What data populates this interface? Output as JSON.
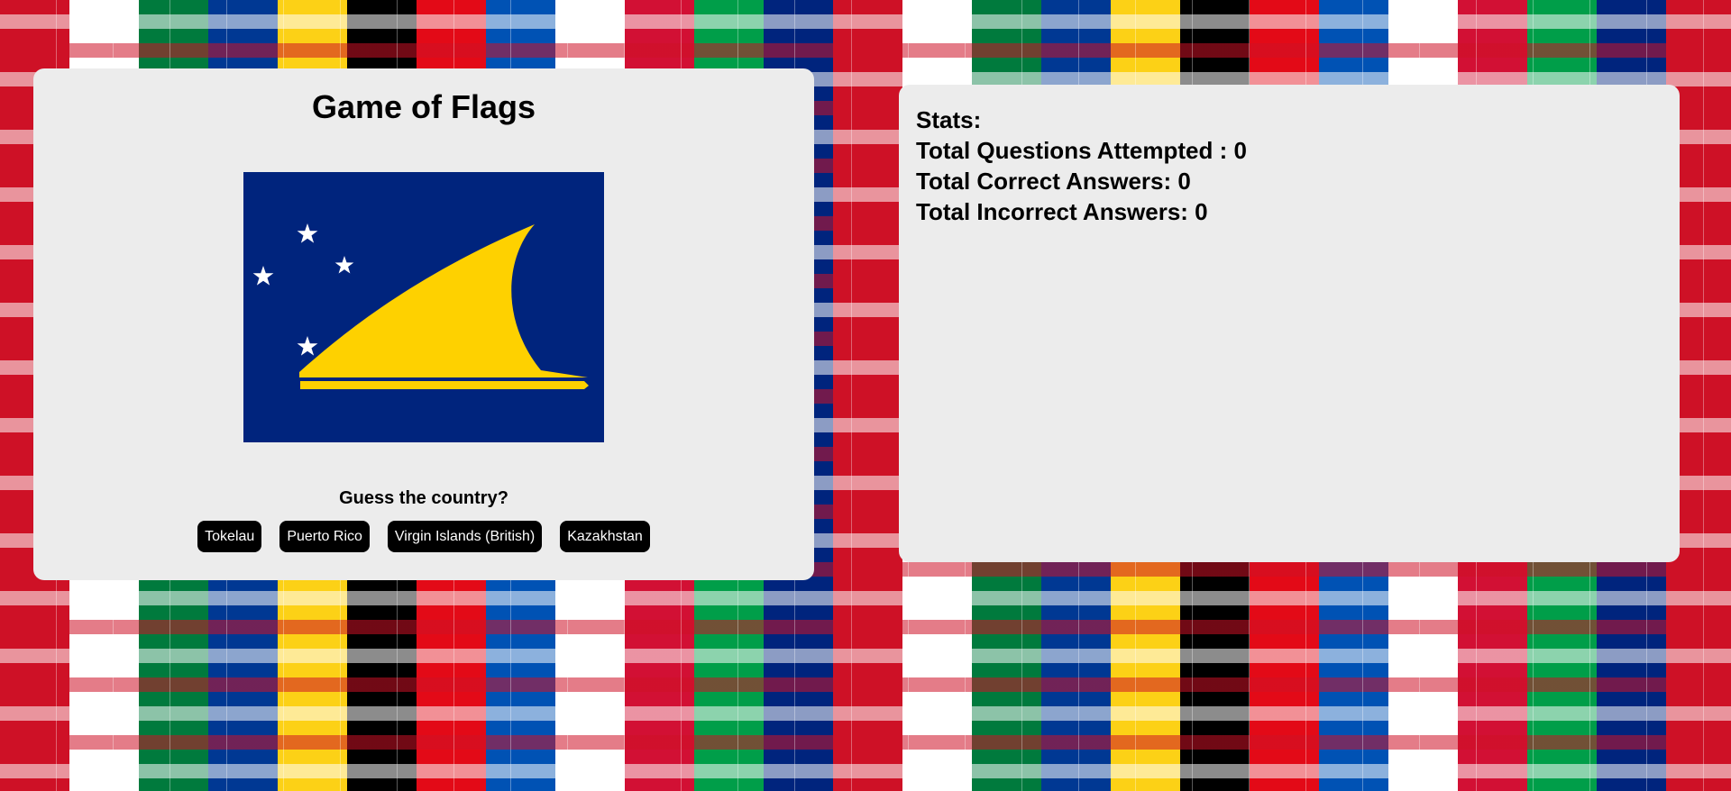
{
  "game": {
    "title": "Game of Flags",
    "flag_icon": "tokelau-flag-icon",
    "question": "Guess the country?",
    "answers": [
      "Tokelau",
      "Puerto Rico",
      "Virgin Islands (British)",
      "Kazakhstan"
    ]
  },
  "stats": {
    "heading": "Stats:",
    "attempted": "Total Questions Attempted : 0",
    "correct": "Total Correct Answers: 0",
    "incorrect": "Total Incorrect Answers: 0"
  },
  "colors": {
    "panel_bg": "#ececec",
    "button_bg": "#000000",
    "flag_blue": "#00247d",
    "flag_yellow": "#fed100"
  }
}
